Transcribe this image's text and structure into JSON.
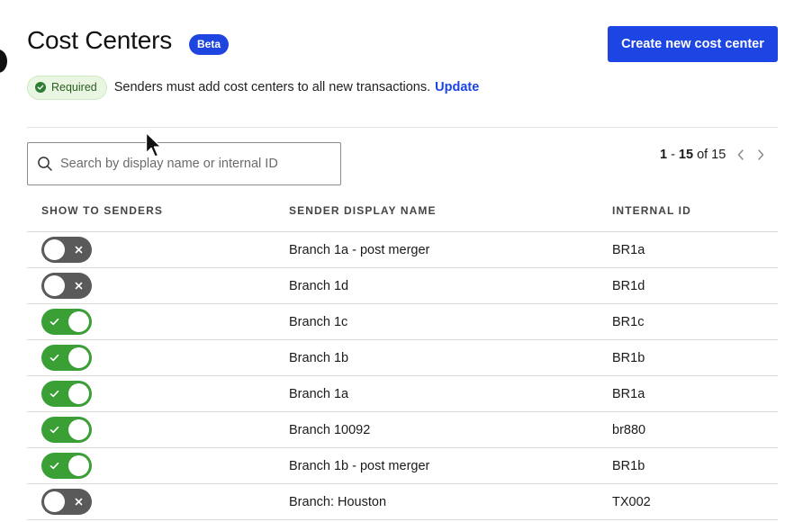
{
  "header": {
    "title": "Cost Centers",
    "beta_label": "Beta",
    "create_button": "Create new cost center"
  },
  "requirement": {
    "badge": "Required",
    "text": "Senders must add cost centers to all new transactions.",
    "link": "Update"
  },
  "search": {
    "placeholder": "Search by display name or internal ID",
    "value": ""
  },
  "pagination": {
    "range_start": "1",
    "range_sep": "-",
    "range_end": "15",
    "of_label": "of",
    "total": "15"
  },
  "table": {
    "columns": [
      "SHOW TO SENDERS",
      "SENDER DISPLAY NAME",
      "INTERNAL ID"
    ],
    "rows": [
      {
        "show_to_senders": false,
        "name": "Branch 1a - post merger",
        "internal_id": "BR1a"
      },
      {
        "show_to_senders": false,
        "name": "Branch 1d",
        "internal_id": "BR1d"
      },
      {
        "show_to_senders": true,
        "name": "Branch 1c",
        "internal_id": "BR1c"
      },
      {
        "show_to_senders": true,
        "name": "Branch 1b",
        "internal_id": "BR1b"
      },
      {
        "show_to_senders": true,
        "name": "Branch 1a",
        "internal_id": "BR1a"
      },
      {
        "show_to_senders": true,
        "name": "Branch 10092",
        "internal_id": "br880"
      },
      {
        "show_to_senders": true,
        "name": "Branch 1b - post merger",
        "internal_id": "BR1b"
      },
      {
        "show_to_senders": false,
        "name": "Branch: Houston",
        "internal_id": "TX002"
      }
    ]
  },
  "colors": {
    "primary": "#1d45e4",
    "toggle_on": "#3aa036",
    "toggle_off": "#5a5a5a",
    "required_bg": "#e8f6e2"
  },
  "icons": {
    "search": "search-icon",
    "prev": "chevron-left-icon",
    "next": "chevron-right-icon",
    "required": "check-circle-icon",
    "toggle_on": "check-icon",
    "toggle_off": "close-icon",
    "pointer": "mouse-cursor-icon"
  }
}
